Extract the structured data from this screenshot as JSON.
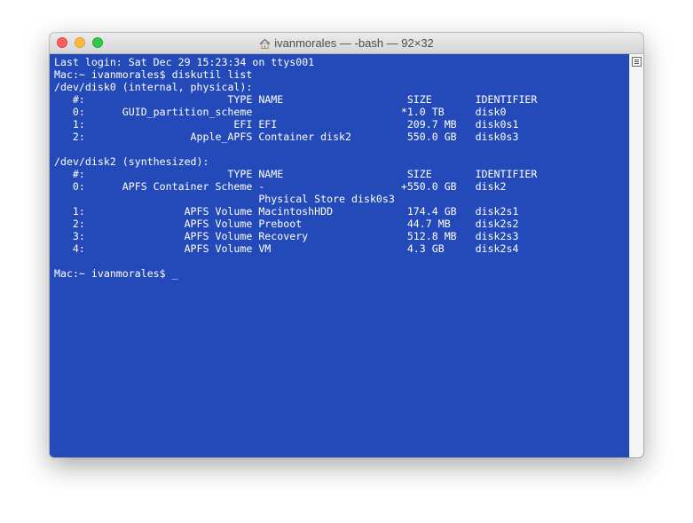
{
  "window": {
    "title": "ivanmorales — -bash — 92×32",
    "title_icon": "home-icon"
  },
  "terminal": {
    "login_line": "Last login: Sat Dec 29 15:23:34 on ttys001",
    "command_line": "Mac:~ ivanmorales$ diskutil list",
    "disk0": {
      "heading": "/dev/disk0 (internal, physical):",
      "header": {
        "num": "#:",
        "type": "TYPE",
        "name": "NAME",
        "mark": "",
        "size": "SIZE",
        "id": "IDENTIFIER"
      },
      "rows": [
        {
          "num": "0:",
          "type": "GUID_partition_scheme",
          "name": "",
          "mark": "*",
          "size": "1.0 TB",
          "id": "disk0"
        },
        {
          "num": "1:",
          "type": "EFI",
          "name": "EFI",
          "mark": "",
          "size": "209.7 MB",
          "id": "disk0s1"
        },
        {
          "num": "2:",
          "type": "Apple_APFS",
          "name": "Container disk2",
          "mark": "",
          "size": "550.0 GB",
          "id": "disk0s3"
        }
      ]
    },
    "disk2": {
      "heading": "/dev/disk2 (synthesized):",
      "header": {
        "num": "#:",
        "type": "TYPE",
        "name": "NAME",
        "mark": "",
        "size": "SIZE",
        "id": "IDENTIFIER"
      },
      "rows": [
        {
          "num": "0:",
          "type": "APFS Container Scheme",
          "name": "-",
          "mark": "+",
          "size": "550.0 GB",
          "id": "disk2"
        },
        {
          "num": "",
          "type": "",
          "name": "Physical Store disk0s3",
          "mark": "",
          "size": "",
          "id": ""
        },
        {
          "num": "1:",
          "type": "APFS Volume",
          "name": "MacintoshHDD",
          "mark": "",
          "size": "174.4 GB",
          "id": "disk2s1"
        },
        {
          "num": "2:",
          "type": "APFS Volume",
          "name": "Preboot",
          "mark": "",
          "size": "44.7 MB",
          "id": "disk2s2"
        },
        {
          "num": "3:",
          "type": "APFS Volume",
          "name": "Recovery",
          "mark": "",
          "size": "512.8 MB",
          "id": "disk2s3"
        },
        {
          "num": "4:",
          "type": "APFS Volume",
          "name": "VM",
          "mark": "",
          "size": "4.3 GB",
          "id": "disk2s4"
        }
      ]
    },
    "prompt": "Mac:~ ivanmorales$ ",
    "cursor": "_"
  },
  "colors": {
    "background": "#2449b8",
    "text": "#ffffff"
  }
}
